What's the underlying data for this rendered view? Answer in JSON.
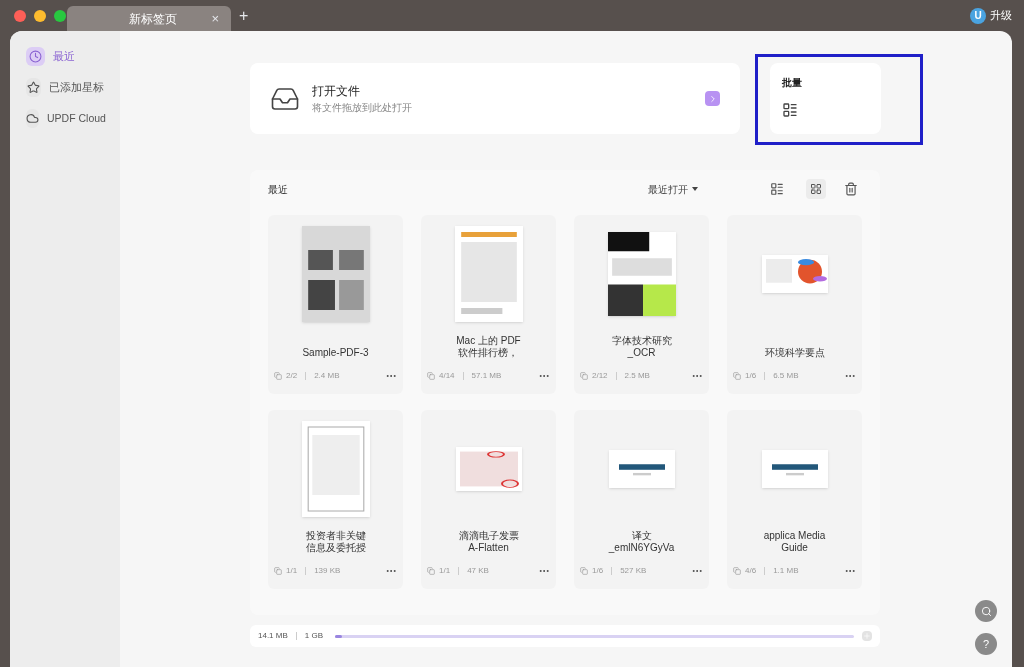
{
  "tab": {
    "title": "新标签页",
    "close": "×",
    "new": "+"
  },
  "upgrade": {
    "badge": "U",
    "label": "升级"
  },
  "sidebar": {
    "items": [
      {
        "label": "最近",
        "selected": true
      },
      {
        "label": "已添加星标",
        "selected": false
      },
      {
        "label": "UPDF Cloud",
        "selected": false
      }
    ]
  },
  "open_file": {
    "title": "打开文件",
    "subtitle": "将文件拖放到此处打开"
  },
  "batch": {
    "title": "批量"
  },
  "recent": {
    "title": "最近",
    "sort": "最近打开",
    "files": [
      {
        "name_lines": [
          "Sample-PDF-3"
        ],
        "pages": "2/2",
        "size": "2.4 MB"
      },
      {
        "name_lines": [
          "Mac 上的 PDF",
          "软件排行榜，"
        ],
        "pages": "4/14",
        "size": "57.1 MB"
      },
      {
        "name_lines": [
          "字体技术研究",
          "_OCR"
        ],
        "pages": "2/12",
        "size": "2.5 MB"
      },
      {
        "name_lines": [
          "环境科学要点"
        ],
        "pages": "1/6",
        "size": "6.5 MB"
      },
      {
        "name_lines": [
          "投资者非关键",
          "信息及委托授"
        ],
        "pages": "1/1",
        "size": "139 KB"
      },
      {
        "name_lines": [
          "滴滴电子发票",
          "A-Flatten"
        ],
        "pages": "1/1",
        "size": "47 KB"
      },
      {
        "name_lines": [
          "译文",
          "_emlN6YGyVa"
        ],
        "pages": "1/6",
        "size": "527 KB"
      },
      {
        "name_lines": [
          "applica Media",
          "Guide"
        ],
        "pages": "4/6",
        "size": "1.1 MB"
      }
    ]
  },
  "storage": {
    "used": "14.1 MB",
    "total": "1 GB",
    "level": 0.014
  },
  "help": {
    "label": "?"
  }
}
